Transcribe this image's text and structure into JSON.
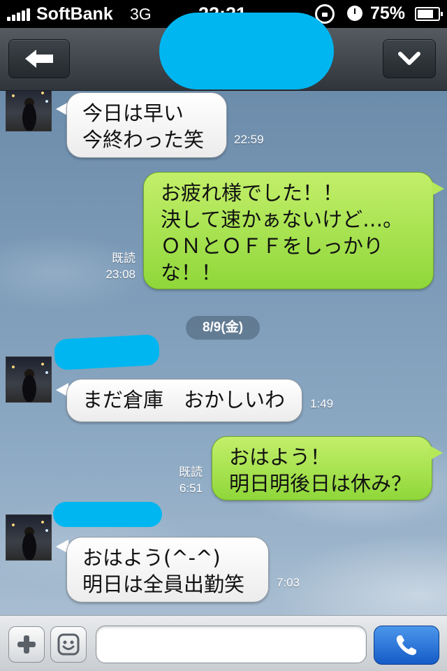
{
  "status_bar": {
    "carrier": "SoftBank",
    "network": "3G",
    "time": "22:21",
    "battery": "75%",
    "icons": [
      "signal-bars-icon",
      "rotation-lock-icon",
      "alarm-clock-icon",
      "battery-icon"
    ]
  },
  "nav": {
    "back_icon": "arrow-left-icon",
    "menu_icon": "chevron-down-icon",
    "title_redacted_color": "#00b6f0"
  },
  "messages": [
    {
      "side": "left",
      "lines": [
        "今日は早い",
        "今終わった笑"
      ],
      "time": "22:59"
    },
    {
      "side": "right",
      "lines": [
        "お疲れ様でした！！",
        "決して速かぁないけど…。",
        "ＯＮとＯＦＦをしっかり",
        "な！！"
      ],
      "read": "既読",
      "time": "23:08"
    },
    {
      "side": "left",
      "lines": [
        "まだ倉庫　おかしいわ"
      ],
      "time": "1:49"
    },
    {
      "side": "right",
      "lines": [
        "おはよう！",
        "明日明後日は休み？"
      ],
      "read": "既読",
      "time": "6:51"
    },
    {
      "side": "left",
      "lines": [
        "おはよう(^-^)",
        "明日は全員出勤笑"
      ],
      "time": "7:03"
    }
  ],
  "date_separator": "8/9(金)",
  "input_bar": {
    "plus_icon": "plus-icon",
    "emoji_icon": "smiley-face-icon",
    "message_value": "",
    "call_icon": "phone-icon"
  },
  "colors": {
    "incoming_bubble": "#ffffff",
    "outgoing_bubble": "#a8e14e",
    "redaction": "#00b6f0",
    "call_button": "#2a73d9"
  }
}
